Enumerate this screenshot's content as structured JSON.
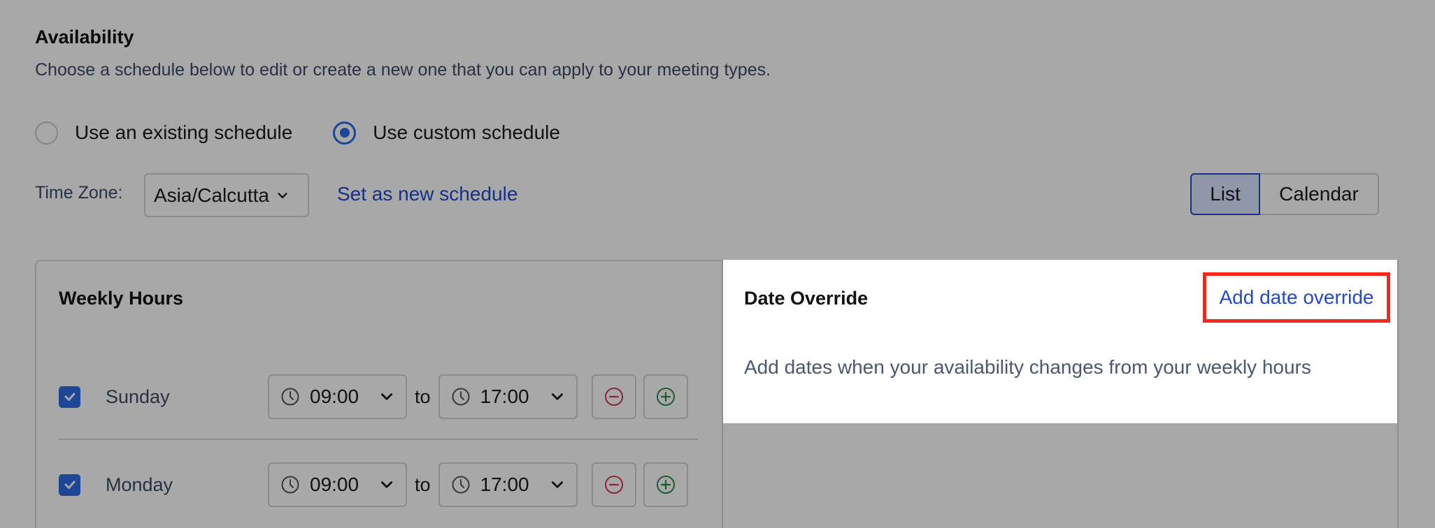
{
  "availability": {
    "title": "Availability",
    "subtitle": "Choose a schedule below to edit or create a new one that you can apply to your meeting types."
  },
  "schedule_mode": {
    "options": [
      {
        "label": "Use an existing schedule",
        "selected": false
      },
      {
        "label": "Use custom schedule",
        "selected": true
      }
    ]
  },
  "timezone": {
    "label": "Time Zone:",
    "value": "Asia/Calcutta",
    "set_new_link": "Set as new schedule"
  },
  "view_toggle": {
    "list": "List",
    "calendar": "Calendar",
    "active": "List"
  },
  "weekly_hours": {
    "title": "Weekly Hours",
    "to_label": "to",
    "days": [
      {
        "name": "Sunday",
        "checked": true,
        "from": "09:00",
        "to": "17:00"
      },
      {
        "name": "Monday",
        "checked": true,
        "from": "09:00",
        "to": "17:00"
      }
    ]
  },
  "date_override": {
    "title": "Date Override",
    "add_link": "Add date override",
    "description": "Add dates when your availability changes from your weekly hours"
  },
  "colors": {
    "accent": "#2d6be4",
    "link": "#2549c9",
    "highlight": "#f0281e",
    "remove": "#d23a55",
    "add": "#2e8b46"
  }
}
